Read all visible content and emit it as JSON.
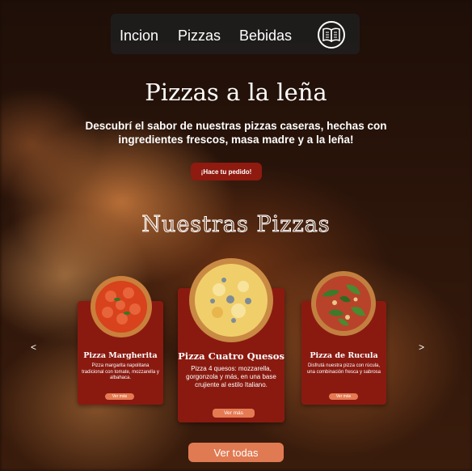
{
  "nav": {
    "links": [
      "Incion",
      "Pizzas",
      "Bebidas"
    ],
    "menu_icon": "book-menu-icon"
  },
  "hero": {
    "title": "Pizzas a la leña",
    "subtitle": "Descubrí el sabor de nuestras pizzas caseras, hechas con ingredientes frescos, masa madre y a la leña!",
    "cta_label": "¡Hace tu pedido!"
  },
  "section": {
    "title": "Nuestras Pizzas",
    "prev_arrow": "<",
    "next_arrow": ">"
  },
  "cards": [
    {
      "title": "Pizza Margherita",
      "description": "Pizza margarita napolitana tradicional con tomate, mozzarella y albahaca.",
      "button": "Ver más"
    },
    {
      "title": "Pizza Cuatro Quesos",
      "description": "Pizza 4 quesos: mozzarella, gorgonzola y más, en una base crujiente al estilo Italiano.",
      "button": "Ver más"
    },
    {
      "title": "Pizza de Rucula",
      "description": "Disfrutá nuestra pizza con rúcula, una combinación fresca y sabrosa",
      "button": "Ver más"
    }
  ],
  "see_all_label": "Ver todas",
  "colors": {
    "card": "#8a1a10",
    "accent_button": "#e07a52",
    "cta": "#8f1a10"
  }
}
